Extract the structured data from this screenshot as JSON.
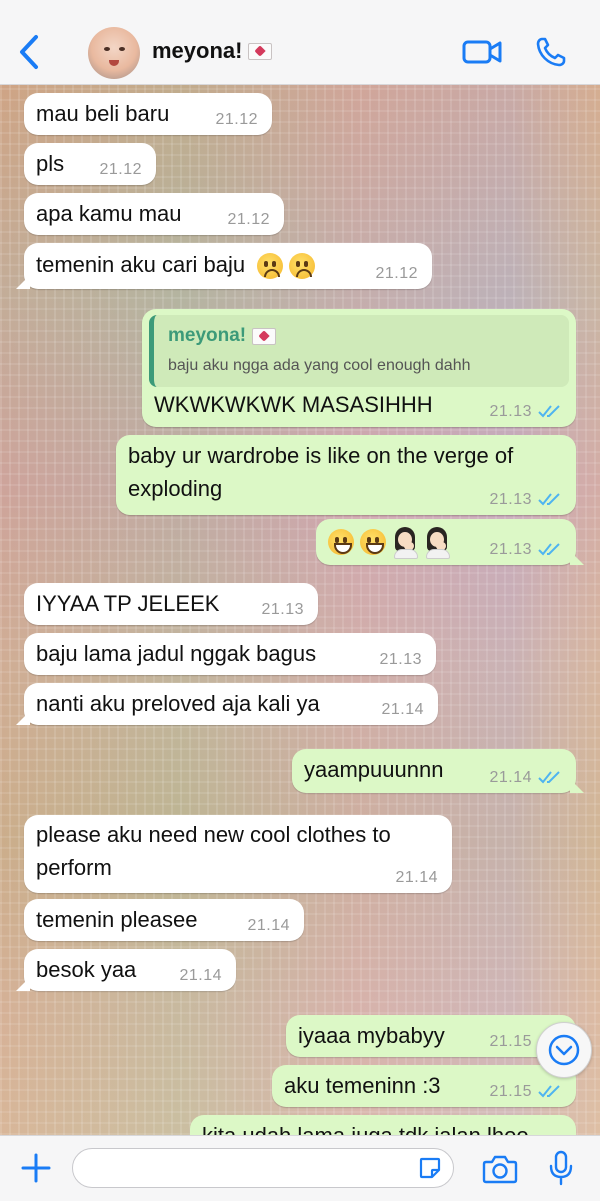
{
  "header": {
    "contact_name": "meyona!",
    "icons": [
      "back-chevron-icon",
      "avatar",
      "envelope-heart-icon",
      "video-camera-icon",
      "phone-icon"
    ]
  },
  "messages": [
    {
      "dir": "in",
      "text": "mau beli baru",
      "time": "21.12"
    },
    {
      "dir": "in",
      "text": "pls",
      "time": "21.12"
    },
    {
      "dir": "in",
      "text": "apa kamu mau",
      "time": "21.12"
    },
    {
      "dir": "in",
      "text": "temenin aku cari baju",
      "emoji": [
        "frowning-face",
        "frowning-face"
      ],
      "time": "21.12"
    },
    {
      "dir": "out",
      "quote_name": "meyona!",
      "quote_text": "baju aku ngga ada yang cool enough dahh",
      "text": "WKWKWKWK MASASIHHH",
      "time": "21.13"
    },
    {
      "dir": "out",
      "text_line1": "baby ur wardrobe is like on the verge of",
      "text_line2": "exploding",
      "time": "21.13"
    },
    {
      "dir": "out",
      "emoji": [
        "grinning-face",
        "grinning-face",
        "woman-facepalming",
        "woman-facepalming"
      ],
      "time": "21.13"
    },
    {
      "dir": "in",
      "text": "IYYAA TP JELEEK",
      "time": "21.13"
    },
    {
      "dir": "in",
      "text": "baju lama jadul nggak bagus",
      "time": "21.13"
    },
    {
      "dir": "in",
      "text": "nanti aku preloved aja kali ya",
      "time": "21.14"
    },
    {
      "dir": "out",
      "text": "yaampuuunnn",
      "time": "21.14"
    },
    {
      "dir": "in",
      "text_line1": "please aku need new cool clothes to",
      "text_line2": "perform",
      "time": "21.14"
    },
    {
      "dir": "in",
      "text": "temenin pleasee",
      "time": "21.14"
    },
    {
      "dir": "in",
      "text": "besok yaa",
      "time": "21.14"
    },
    {
      "dir": "out",
      "text": "iyaaa mybabyy",
      "time": "21.15"
    },
    {
      "dir": "out",
      "text": "aku temeninn :3",
      "time": "21.15"
    },
    {
      "dir": "out",
      "text": "kita udah lama juga tdk jalan lhoo",
      "time": ""
    }
  ],
  "composer": {
    "placeholder": "",
    "icons": [
      "plus-icon",
      "sticker-icon",
      "camera-icon",
      "microphone-icon"
    ]
  },
  "scroll_to_bottom": "chevron-down-icon",
  "colors": {
    "ios_blue": "#1a7cf5",
    "incoming_bubble": "#ffffff",
    "outgoing_bubble": "#dcf8c6",
    "quote_accent": "#3c9a79",
    "read_ticks": "#4fb4f0"
  }
}
